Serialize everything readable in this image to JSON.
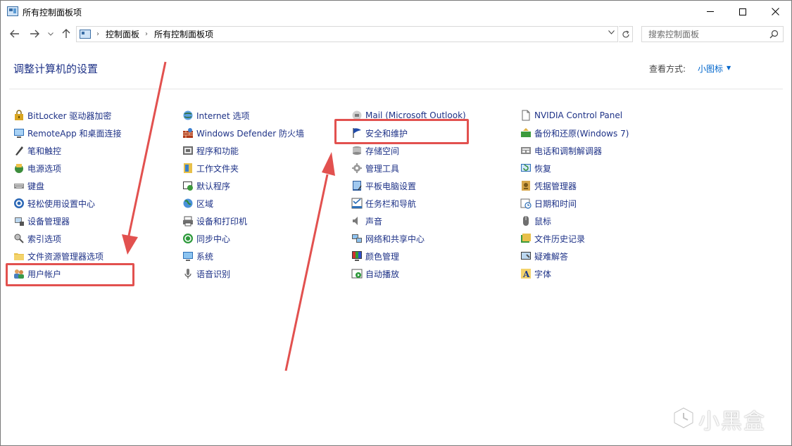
{
  "window": {
    "title": "所有控制面板项",
    "minimize_label": "—",
    "close_label": "✕"
  },
  "address": {
    "breadcrumbs": [
      "控制面板",
      "所有控制面板项"
    ]
  },
  "search": {
    "placeholder": "搜索控制面板"
  },
  "header": {
    "title": "调整计算机的设置",
    "view_by_label": "查看方式:",
    "view_by_value": "小图标"
  },
  "columns": [
    {
      "items": [
        {
          "label": "BitLocker 驱动器加密",
          "icon": "bitlocker-icon"
        },
        {
          "label": "RemoteApp 和桌面连接",
          "icon": "remoteapp-icon"
        },
        {
          "label": "笔和触控",
          "icon": "pen-icon"
        },
        {
          "label": "电源选项",
          "icon": "power-icon"
        },
        {
          "label": "键盘",
          "icon": "keyboard-icon"
        },
        {
          "label": "轻松使用设置中心",
          "icon": "ease-of-access-icon"
        },
        {
          "label": "设备管理器",
          "icon": "device-manager-icon"
        },
        {
          "label": "索引选项",
          "icon": "indexing-icon"
        },
        {
          "label": "文件资源管理器选项",
          "icon": "folder-options-icon"
        },
        {
          "label": "用户帐户",
          "icon": "user-accounts-icon"
        }
      ]
    },
    {
      "items": [
        {
          "label": "Internet 选项",
          "icon": "internet-icon"
        },
        {
          "label": "Windows Defender 防火墙",
          "icon": "firewall-icon"
        },
        {
          "label": "程序和功能",
          "icon": "programs-icon"
        },
        {
          "label": "工作文件夹",
          "icon": "work-folders-icon"
        },
        {
          "label": "默认程序",
          "icon": "default-programs-icon"
        },
        {
          "label": "区域",
          "icon": "region-icon"
        },
        {
          "label": "设备和打印机",
          "icon": "printer-icon"
        },
        {
          "label": "同步中心",
          "icon": "sync-icon"
        },
        {
          "label": "系统",
          "icon": "system-icon"
        },
        {
          "label": "语音识别",
          "icon": "microphone-icon"
        }
      ]
    },
    {
      "items": [
        {
          "label": "Mail (Microsoft Outlook)",
          "icon": "mail-icon"
        },
        {
          "label": "安全和维护",
          "icon": "flag-icon"
        },
        {
          "label": "存储空间",
          "icon": "storage-icon"
        },
        {
          "label": "管理工具",
          "icon": "admin-tools-icon"
        },
        {
          "label": "平板电脑设置",
          "icon": "tablet-icon"
        },
        {
          "label": "任务栏和导航",
          "icon": "taskbar-icon"
        },
        {
          "label": "声音",
          "icon": "speaker-icon"
        },
        {
          "label": "网络和共享中心",
          "icon": "network-icon"
        },
        {
          "label": "颜色管理",
          "icon": "color-icon"
        },
        {
          "label": "自动播放",
          "icon": "autoplay-icon"
        }
      ]
    },
    {
      "items": [
        {
          "label": "NVIDIA Control Panel",
          "icon": "nvidia-icon"
        },
        {
          "label": "备份和还原(Windows 7)",
          "icon": "backup-icon"
        },
        {
          "label": "电话和调制解调器",
          "icon": "phone-icon"
        },
        {
          "label": "恢复",
          "icon": "recovery-icon"
        },
        {
          "label": "凭据管理器",
          "icon": "credential-icon"
        },
        {
          "label": "日期和时间",
          "icon": "clock-icon"
        },
        {
          "label": "鼠标",
          "icon": "mouse-icon"
        },
        {
          "label": "文件历史记录",
          "icon": "file-history-icon"
        },
        {
          "label": "疑难解答",
          "icon": "troubleshoot-icon"
        },
        {
          "label": "字体",
          "icon": "font-icon"
        }
      ]
    }
  ],
  "watermark": "小黑盒"
}
